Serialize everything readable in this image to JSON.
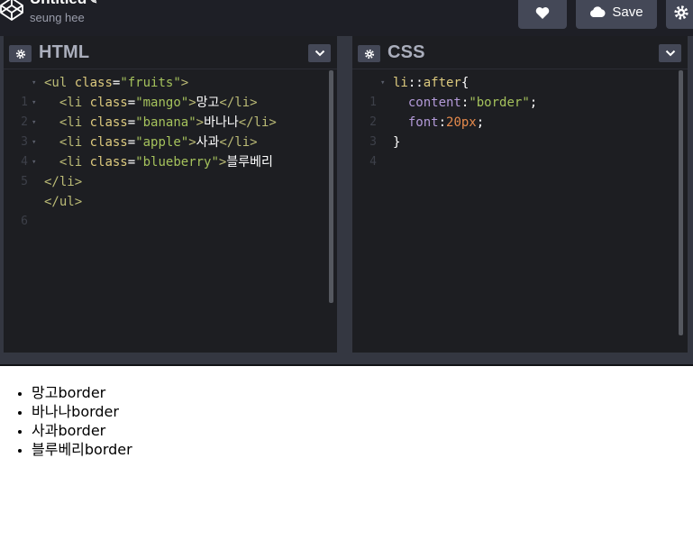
{
  "header": {
    "pen_title": "Untitled",
    "user_name": "seung hee",
    "save_label": "Save"
  },
  "editors": {
    "html": {
      "title": "HTML",
      "lines": [
        {
          "num": "1",
          "fold": "▾"
        },
        {
          "num": "2",
          "fold": "▾"
        },
        {
          "num": "3",
          "fold": "▾"
        },
        {
          "num": "4",
          "fold": "▾"
        },
        {
          "num": "5",
          "fold": "▾"
        },
        {
          "num": "",
          "fold": ""
        },
        {
          "num": "6",
          "fold": ""
        }
      ]
    },
    "css": {
      "title": "CSS",
      "lines": [
        {
          "num": "1",
          "fold": "▾"
        },
        {
          "num": "2",
          "fold": ""
        },
        {
          "num": "3",
          "fold": ""
        },
        {
          "num": "4",
          "fold": ""
        }
      ]
    }
  },
  "preview": {
    "items": [
      "망고border",
      "바나나border",
      "사과border",
      "블루베리border"
    ]
  },
  "colors": {
    "editor_bg": "#1d1e22",
    "header_bg": "#1e1f26",
    "button_bg": "#444857",
    "gutter_bg": "#343741",
    "tag": "#bbbb76",
    "attr": "#ddca7e",
    "string": "#a5c25c",
    "property": "#b39ad8",
    "number": "#e58a4c"
  }
}
